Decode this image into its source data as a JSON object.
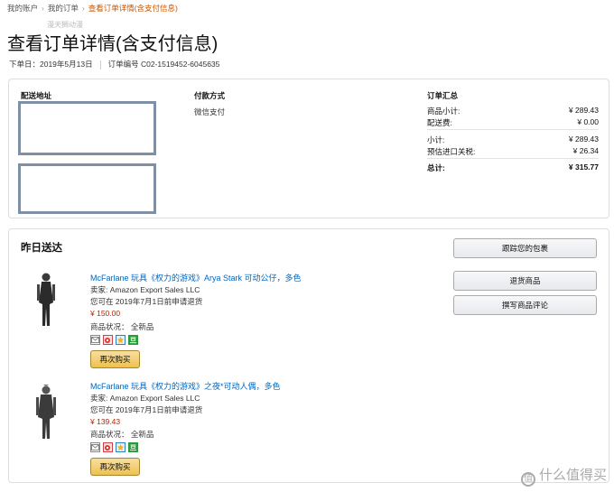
{
  "breadcrumb": {
    "items": [
      "我的账户",
      "我的订单"
    ],
    "current": "查看订单详情(含支付信息)"
  },
  "watermark_top": "漫天狮动漫",
  "page_title": "查看订单详情(含支付信息)",
  "order_meta": {
    "date": "下单日：2019年5月13日",
    "number": "订单编号 C02-1519452-6045635"
  },
  "summary_box": {
    "shipping_header": "配送地址",
    "payment_header": "付款方式",
    "payment_method": "微信支付",
    "totals_header": "订单汇总",
    "rows": [
      {
        "label": "商品小计:",
        "value": "¥ 289.43"
      },
      {
        "label": "配送费:",
        "value": "¥ 0.00"
      },
      {
        "label": "小计:",
        "value": "¥ 289.43"
      },
      {
        "label": "预估进口关税:",
        "value": "¥ 26.34"
      },
      {
        "label": "总计:",
        "value": "¥ 315.77"
      }
    ]
  },
  "shipment": {
    "status": "昨日送达",
    "buttons": {
      "track": "跟踪您的包裹",
      "return": "退货商品",
      "review": "撰写商品评论"
    },
    "items": [
      {
        "title": "McFarlane 玩具《权力的游戏》Arya Stark 可动公仔，多色",
        "seller": "卖家: Amazon Export Sales LLC",
        "return_note": "您可在 2019年7月1日前申请退货",
        "price": "¥ 150.00",
        "condition": "商品状况：   全新品",
        "buy_again": "再次购买"
      },
      {
        "title": "McFarlane 玩具《权力的游戏》之夜*可动人偶，多色",
        "seller": "卖家: Amazon Export Sales LLC",
        "return_note": "您可在 2019年7月1日前申请退货",
        "price": "¥ 139.43",
        "condition": "商品状况：   全新品",
        "buy_again": "再次购买"
      }
    ]
  },
  "watermark_bottom": "什么值得买",
  "colors": {
    "link": "#0066c0",
    "price": "#b12704",
    "breadcrumb_current": "#c45500",
    "buy_again": "#f0c14b"
  }
}
